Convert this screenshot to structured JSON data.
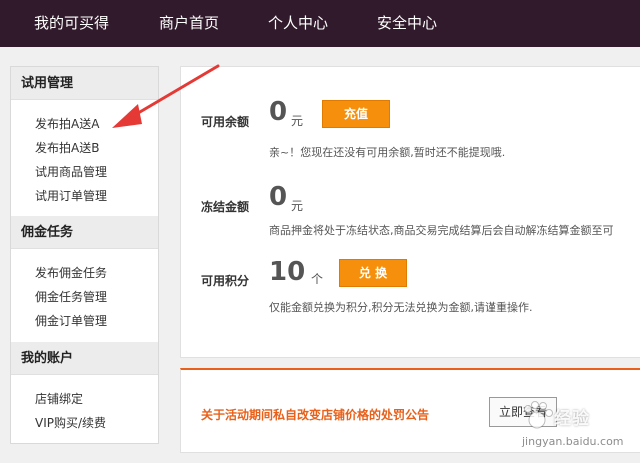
{
  "nav": {
    "items": [
      "我的可买得",
      "商户首页",
      "个人中心",
      "安全中心"
    ]
  },
  "sidebar": {
    "sections": [
      {
        "title": "试用管理",
        "items": [
          "发布拍A送A",
          "发布拍A送B",
          "试用商品管理",
          "试用订单管理"
        ]
      },
      {
        "title": "佣金任务",
        "items": [
          "发布佣金任务",
          "佣金任务管理",
          "佣金订单管理"
        ]
      },
      {
        "title": "我的账户",
        "items": [
          "店铺绑定",
          "VIP购买/续费"
        ]
      }
    ]
  },
  "balance": {
    "label": "可用余额",
    "value": "0",
    "unit": "元",
    "button": "充值",
    "note": "亲~！您现在还没有可用余额,暂时还不能提现哦."
  },
  "frozen": {
    "label": "冻结金额",
    "value": "0",
    "unit": "元",
    "note": "商品押金将处于冻结状态,商品交易完成结算后会自动解冻结算金额至可"
  },
  "points": {
    "label": "可用积分",
    "value": "10",
    "unit": "个",
    "button": "兑 换",
    "note": "仅能金额兑换为积分,积分无法兑换为金额,请谨重操作."
  },
  "notice": {
    "text": "关于活动期间私自改变店铺价格的处罚公告",
    "button": "立即查看"
  },
  "watermark": {
    "logo": "经验",
    "url": "jingyan.baidu.com"
  },
  "colors": {
    "nav_bg": "#301a2b",
    "accent": "#f6900c",
    "notice": "#e8601a",
    "arrow": "#e53935"
  }
}
